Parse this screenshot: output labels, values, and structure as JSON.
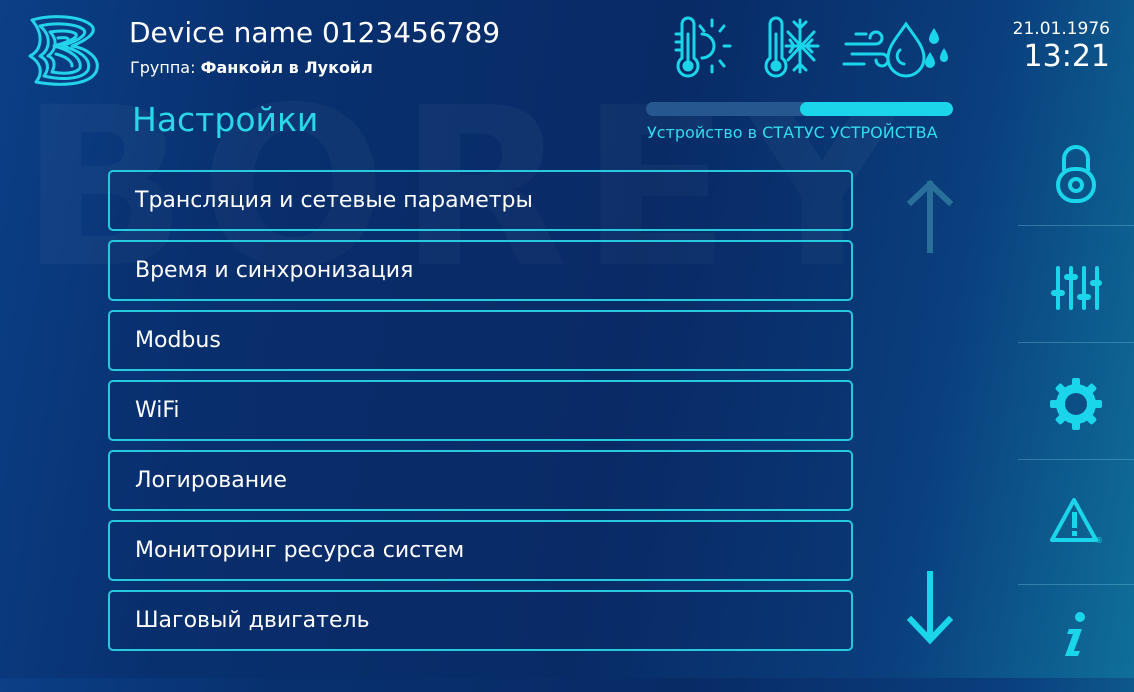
{
  "header": {
    "device_name": "Device name 0123456789",
    "group_label": "Группа:",
    "group_value": "Фанкойл в Лукойл",
    "date": "21.01.1976",
    "time": "13:21"
  },
  "page": {
    "title": "Настройки",
    "watermark": "BOREY"
  },
  "modes": [
    {
      "name": "heating-mode-icon"
    },
    {
      "name": "cooling-mode-icon"
    },
    {
      "name": "ventilation-humidity-icon"
    }
  ],
  "status": {
    "progress": 0.5,
    "text": "Устройство в СТАТУС УСТРОЙСТВА"
  },
  "menu": {
    "items": [
      {
        "label": "Трансляция и сетевые параметры"
      },
      {
        "label": "Время и синхронизация"
      },
      {
        "label": "Modbus"
      },
      {
        "label": "WiFi"
      },
      {
        "label": "Логирование"
      },
      {
        "label": "Мониторинг ресурса систем"
      },
      {
        "label": "Шаговый двигатель"
      }
    ]
  },
  "sidebar": {
    "items": [
      "lock-icon",
      "sliders-icon",
      "gear-icon",
      "warning-icon",
      "info-icon"
    ]
  },
  "colors": {
    "accent": "#1bd6ea",
    "background": "#082b66",
    "text": "#ffffff"
  }
}
